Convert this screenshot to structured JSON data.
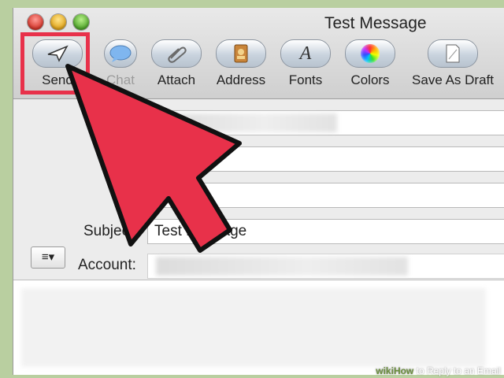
{
  "window": {
    "title": "Test Message"
  },
  "toolbar": {
    "items": [
      {
        "label": "Send",
        "icon": "paper-plane-icon",
        "disabled": false
      },
      {
        "label": "Chat",
        "icon": "chat-bubble-icon",
        "disabled": true
      },
      {
        "label": "Attach",
        "icon": "paperclip-icon",
        "disabled": false
      },
      {
        "label": "Address",
        "icon": "address-book-icon",
        "disabled": false
      },
      {
        "label": "Fonts",
        "icon": "font-a-icon",
        "disabled": false
      },
      {
        "label": "Colors",
        "icon": "color-wheel-icon",
        "disabled": false
      },
      {
        "label": "Save As Draft",
        "icon": "draft-page-icon",
        "disabled": false
      }
    ]
  },
  "headers": {
    "subject_label": "Subject:",
    "subject_value": "Test Message",
    "account_label": "Account:",
    "account_menu_glyph": "≡▾"
  },
  "colors": {
    "highlight": "#e8314a",
    "arrow_fill": "#e8314a",
    "frame_green": "#b9cfa0"
  },
  "watermark": {
    "brand_a": "wiki",
    "brand_b": "How",
    "text": " to Reply to an Email"
  }
}
